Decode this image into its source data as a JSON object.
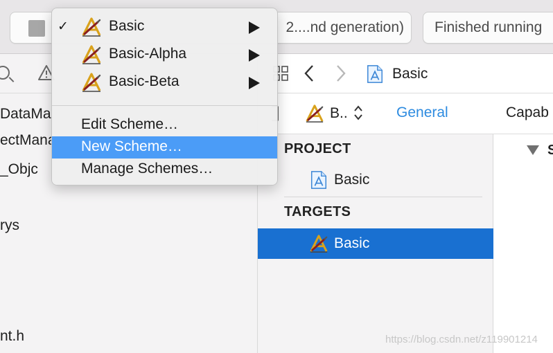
{
  "toolbar": {
    "scheme_text": "2....nd generation)",
    "activity_text": "Finished running"
  },
  "scheme_menu": {
    "schemes": [
      {
        "label": "Basic",
        "checked": true,
        "icon": "app-target-icon"
      },
      {
        "label": "Basic-Alpha",
        "checked": false,
        "icon": "app-target-icon"
      },
      {
        "label": "Basic-Beta",
        "checked": false,
        "icon": "app-target-icon"
      }
    ],
    "check_glyph": "✓",
    "actions": [
      {
        "label": "Edit Scheme…",
        "highlighted": false
      },
      {
        "label": "New Scheme…",
        "highlighted": true
      },
      {
        "label": "Manage Schemes…",
        "highlighted": false
      }
    ],
    "highlight_color": "#4b9cf7"
  },
  "navigator": {
    "rows": [
      "DataMa",
      "ectMana",
      "_Objc",
      "rys",
      "nt.h"
    ]
  },
  "editor": {
    "back_glyph": "〈",
    "forward_glyph": "〉",
    "breadcrumb": "Basic",
    "target_selector": "B..",
    "tabs": [
      "General",
      "Capab"
    ],
    "active_tab_color": "#2d8be0"
  },
  "outline": {
    "project_header": "PROJECT",
    "project_item": "Basic",
    "targets_header": "TARGETS",
    "target_item": "Basic",
    "selection_color": "#1970d1"
  },
  "detail": {
    "section_label": "S"
  },
  "watermark": "https://blog.csdn.net/z119901214"
}
